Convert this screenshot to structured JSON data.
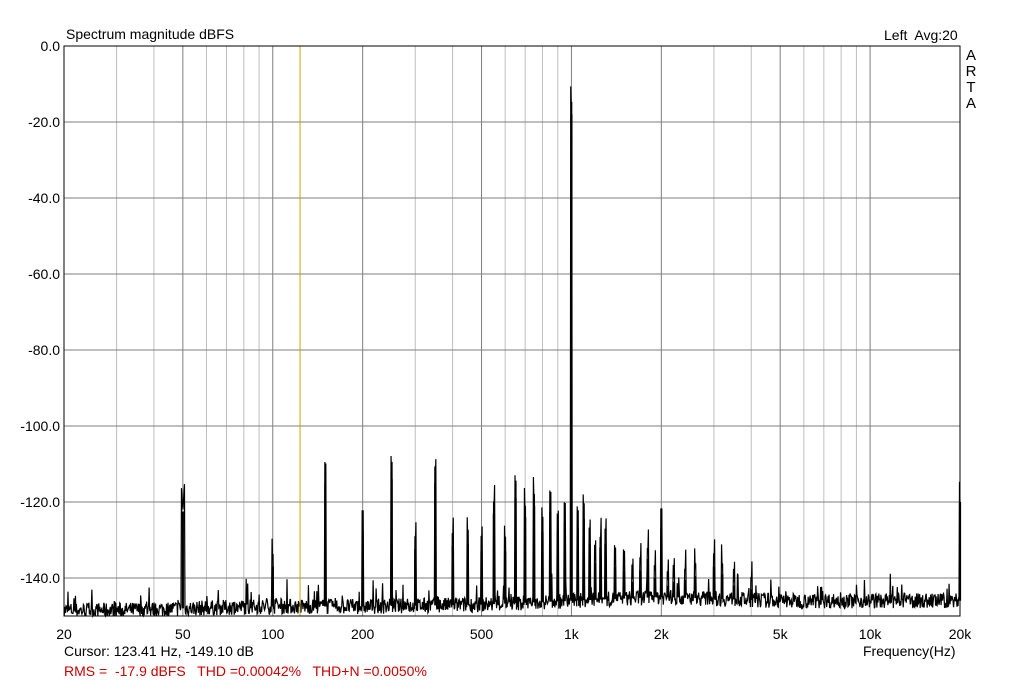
{
  "chart_data": {
    "type": "line",
    "title": "Spectrum magnitude dBFS",
    "channel_label": "Left",
    "averaging_label": "Avg:20",
    "brand": "ARTA",
    "xlabel": "Frequency(Hz)",
    "ylabel": "",
    "x_scale": "log",
    "xlim": [
      20,
      20000
    ],
    "ylim": [
      -150,
      0
    ],
    "grid": true,
    "x_ticks": [
      {
        "value": 20,
        "label": "20"
      },
      {
        "value": 50,
        "label": "50"
      },
      {
        "value": 100,
        "label": "100"
      },
      {
        "value": 200,
        "label": "200"
      },
      {
        "value": 500,
        "label": "500"
      },
      {
        "value": 1000,
        "label": "1k"
      },
      {
        "value": 2000,
        "label": "2k"
      },
      {
        "value": 5000,
        "label": "5k"
      },
      {
        "value": 10000,
        "label": "10k"
      },
      {
        "value": 20000,
        "label": "20k"
      }
    ],
    "y_ticks": [
      {
        "value": 0,
        "label": "0.0"
      },
      {
        "value": -20,
        "label": "-20.0"
      },
      {
        "value": -40,
        "label": "-40.0"
      },
      {
        "value": -60,
        "label": "-60.0"
      },
      {
        "value": -80,
        "label": "-80.0"
      },
      {
        "value": -100,
        "label": "-100.0"
      },
      {
        "value": -120,
        "label": "-120.0"
      },
      {
        "value": -140,
        "label": "-140.0"
      }
    ],
    "cursor_x": 123.41,
    "series": [
      {
        "noise_floor": [
          [
            20,
            -148.5
          ],
          [
            30,
            -148.5
          ],
          [
            50,
            -148
          ],
          [
            100,
            -147.5
          ],
          [
            200,
            -147.5
          ],
          [
            500,
            -147
          ],
          [
            1000,
            -146
          ],
          [
            2000,
            -145
          ],
          [
            5000,
            -146
          ],
          [
            10000,
            -146
          ],
          [
            18000,
            -146
          ],
          [
            20000,
            -146
          ]
        ],
        "peaks": [
          [
            50,
            -122.5
          ],
          [
            100,
            -137
          ],
          [
            150,
            -115
          ],
          [
            200,
            -127.5
          ],
          [
            250,
            -114
          ],
          [
            300,
            -132.5
          ],
          [
            350,
            -115
          ],
          [
            400,
            -131.5
          ],
          [
            450,
            -131
          ],
          [
            500,
            -133
          ],
          [
            550,
            -123
          ],
          [
            600,
            -133
          ],
          [
            650,
            -119
          ],
          [
            700,
            -124
          ],
          [
            750,
            -121
          ],
          [
            800,
            -128
          ],
          [
            850,
            -122.5
          ],
          [
            900,
            -128
          ],
          [
            950,
            -125.5
          ],
          [
            1000,
            -18
          ],
          [
            1050,
            -127
          ],
          [
            1100,
            -124.5
          ],
          [
            1150,
            -131
          ],
          [
            1200,
            -136
          ],
          [
            1250,
            -132
          ],
          [
            1300,
            -131
          ],
          [
            1400,
            -137
          ],
          [
            1500,
            -138
          ],
          [
            1600,
            -141
          ],
          [
            1700,
            -138
          ],
          [
            1800,
            -135
          ],
          [
            1900,
            -140
          ],
          [
            2000,
            -127
          ],
          [
            2100,
            -142
          ],
          [
            2200,
            -141
          ],
          [
            2400,
            -140.5
          ],
          [
            2600,
            -139.5
          ],
          [
            3000,
            -137
          ],
          [
            3200,
            -139
          ],
          [
            3500,
            -142
          ],
          [
            4000,
            -143
          ],
          [
            20000,
            -120
          ]
        ]
      }
    ],
    "cursor_readout": "Cursor: 123.41 Hz, -149.10 dB",
    "stats_readout": "RMS =  -17.9 dBFS   THD =0.00042%   THD+N =0.0050%"
  },
  "colors": {
    "plot_background": "#ffffff",
    "grid_major": "#7f7f7f",
    "grid_minor": "#bfbfbf",
    "trace": "#000000",
    "cursor": "#c8a800",
    "stats_text": "#cc0000"
  }
}
